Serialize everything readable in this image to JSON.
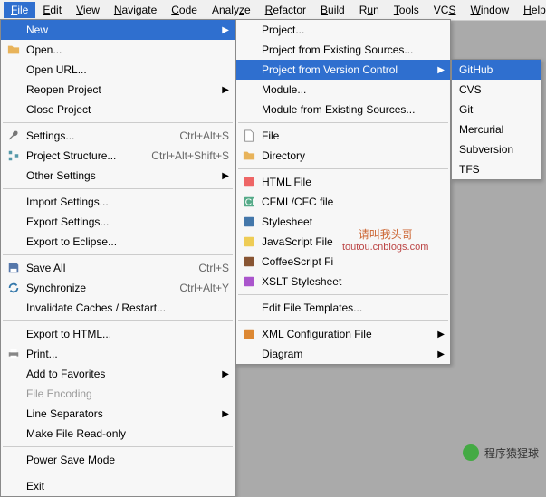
{
  "menubar": [
    "File",
    "Edit",
    "View",
    "Navigate",
    "Code",
    "Analyze",
    "Refactor",
    "Build",
    "Run",
    "Tools",
    "VCS",
    "Window",
    "Help"
  ],
  "file_menu": {
    "new": "New",
    "open": "Open...",
    "open_url": "Open URL...",
    "reopen": "Reopen Project",
    "close": "Close Project",
    "settings": "Settings...",
    "settings_sc": "Ctrl+Alt+S",
    "proj_struct": "Project Structure...",
    "proj_struct_sc": "Ctrl+Alt+Shift+S",
    "other_settings": "Other Settings",
    "import_settings": "Import Settings...",
    "export_settings": "Export Settings...",
    "export_eclipse": "Export to Eclipse...",
    "save_all": "Save All",
    "save_all_sc": "Ctrl+S",
    "sync": "Synchronize",
    "sync_sc": "Ctrl+Alt+Y",
    "invalidate": "Invalidate Caches / Restart...",
    "export_html": "Export to HTML...",
    "print": "Print...",
    "add_fav": "Add to Favorites",
    "file_enc": "File Encoding",
    "line_sep": "Line Separators",
    "readonly": "Make File Read-only",
    "power_save": "Power Save Mode",
    "exit": "Exit"
  },
  "new_menu": {
    "project": "Project...",
    "proj_existing": "Project from Existing Sources...",
    "proj_vcs": "Project from Version Control",
    "module": "Module...",
    "module_existing": "Module from Existing Sources...",
    "file": "File",
    "directory": "Directory",
    "html": "HTML File",
    "cfml": "CFML/CFC file",
    "stylesheet": "Stylesheet",
    "js": "JavaScript File",
    "coffee": "CoffeeScript Fi",
    "xslt": "XSLT Stylesheet",
    "edit_tpl": "Edit File Templates...",
    "xml_cfg": "XML Configuration File",
    "diagram": "Diagram"
  },
  "vcs_menu": {
    "github": "GitHub",
    "cvs": "CVS",
    "git": "Git",
    "mercurial": "Mercurial",
    "subversion": "Subversion",
    "tfs": "TFS"
  },
  "watermark": {
    "line1": "请叫我头哥",
    "line2": "toutou.cnblogs.com"
  },
  "footer": "程序猿猩球"
}
